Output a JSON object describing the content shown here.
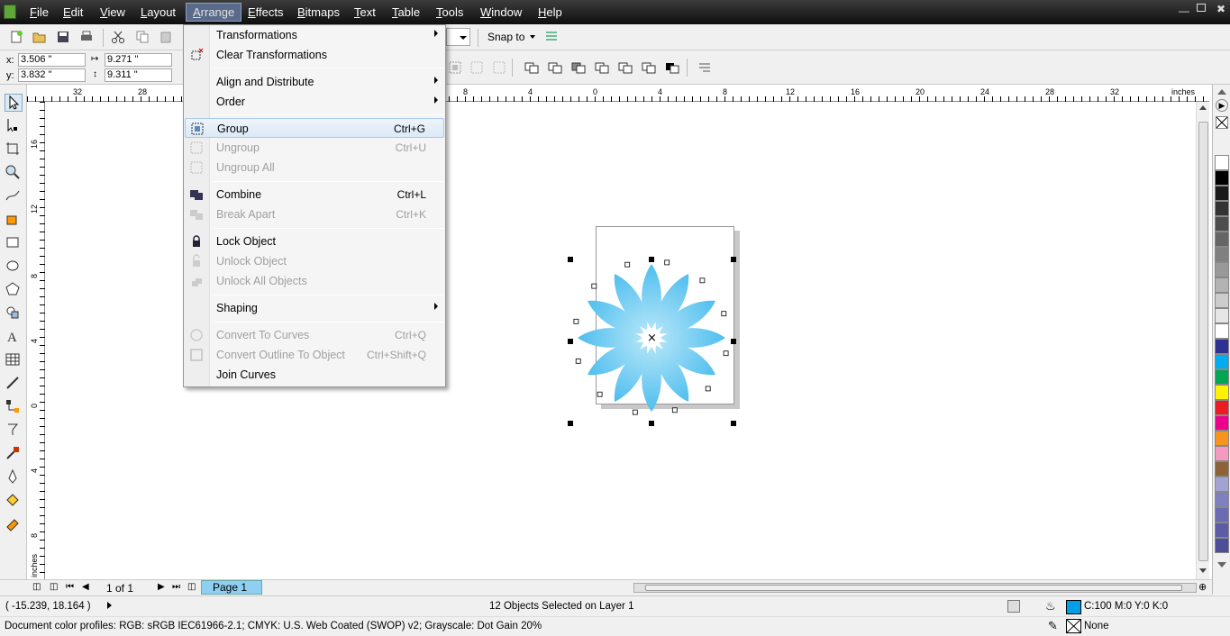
{
  "menubar": {
    "items": [
      {
        "label": "File",
        "u": "F",
        "rest": "ile"
      },
      {
        "label": "Edit",
        "u": "E",
        "rest": "dit"
      },
      {
        "label": "View",
        "u": "V",
        "rest": "iew"
      },
      {
        "label": "Layout",
        "u": "L",
        "rest": "ayout"
      },
      {
        "label": "Arrange",
        "u": "A",
        "rest": "rrange"
      },
      {
        "label": "Effects",
        "u": "E",
        "rest": "ffects"
      },
      {
        "label": "Bitmaps",
        "u": "B",
        "rest": "itmaps"
      },
      {
        "label": "Text",
        "u": "T",
        "rest": "ext"
      },
      {
        "label": "Table",
        "u": "T",
        "rest": "able"
      },
      {
        "label": "Tools",
        "u": "T",
        "rest": "ools"
      },
      {
        "label": "Window",
        "u": "W",
        "rest": "indow"
      },
      {
        "label": "Help",
        "u": "H",
        "rest": "elp"
      }
    ]
  },
  "toolbar": {
    "snap_to": "Snap to"
  },
  "props": {
    "x_label": "x:",
    "x_value": "3.506 \"",
    "y_label": "y:",
    "y_value": "3.832 \"",
    "w_value": "9.271 \"",
    "h_value": "9.311 \""
  },
  "hruler": {
    "ticks": [
      "32",
      "28",
      "8",
      "4",
      "0",
      "4",
      "8",
      "12",
      "16",
      "20",
      "24",
      "28",
      "32"
    ],
    "units": "inches"
  },
  "vruler": {
    "ticks": [
      "16",
      "12",
      "8",
      "4",
      "0",
      "4",
      "8"
    ],
    "units": "inches"
  },
  "arrange_menu": {
    "transformations": "Transformations",
    "clear_transformations": "Clear Transformations",
    "align_distribute": "Align and Distribute",
    "order": "Order",
    "group": "Group",
    "group_sc": "Ctrl+G",
    "ungroup": "Ungroup",
    "ungroup_sc": "Ctrl+U",
    "ungroup_all": "Ungroup All",
    "combine": "Combine",
    "combine_sc": "Ctrl+L",
    "break_apart": "Break  Apart",
    "break_apart_sc": "Ctrl+K",
    "lock_object": "Lock Object",
    "unlock_object": "Unlock Object",
    "unlock_all": "Unlock All Objects",
    "shaping": "Shaping",
    "convert_curves": "Convert To Curves",
    "convert_curves_sc": "Ctrl+Q",
    "convert_outline": "Convert Outline To Object",
    "convert_outline_sc": "Ctrl+Shift+Q",
    "join_curves": "Join Curves"
  },
  "pagenav": {
    "page_count": "1 of 1",
    "page_tab": "Page 1"
  },
  "status": {
    "coords": "( -15.239, 18.164 )",
    "selection": "12 Objects Selected on Layer 1",
    "fill": "C:100 M:0 Y:0 K:0",
    "outline": "None",
    "profiles": "Document color profiles: RGB: sRGB IEC61966-2.1; CMYK: U.S. Web Coated (SWOP) v2; Grayscale: Dot Gain 20%"
  },
  "colors": {
    "fill": "#00a0e9",
    "petal": "#4fc0ef",
    "palette": [
      "#ffffff",
      "#000000",
      "#1a1a1a",
      "#333333",
      "#4d4d4d",
      "#666666",
      "#808080",
      "#999999",
      "#b3b3b3",
      "#cccccc",
      "#e6e6e6",
      "#ffffff",
      "#2e3192",
      "#00aeef",
      "#00a651",
      "#fff200",
      "#ed1c24",
      "#ec008c",
      "#f7941d",
      "#f49ac1",
      "#8c6239",
      "#a3a3d1",
      "#8080c0",
      "#6b6bb3",
      "#5c5ca6",
      "#4d4d99"
    ]
  }
}
